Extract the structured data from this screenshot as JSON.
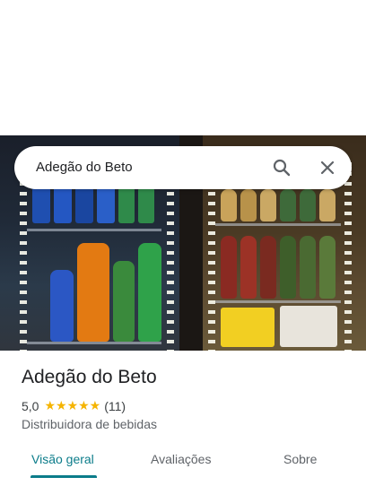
{
  "search": {
    "query": "Adegão do Beto"
  },
  "icons": {
    "search": "search-icon",
    "close": "close-icon"
  },
  "place": {
    "title": "Adegão do Beto",
    "rating": "5,0",
    "stars": "★★★★★",
    "review_count": "(11)",
    "category": "Distribuidora de bebidas"
  },
  "tabs": [
    {
      "label": "Visão geral"
    },
    {
      "label": "Avaliações"
    },
    {
      "label": "Sobre"
    }
  ],
  "colors": {
    "accent": "#0b7c8a",
    "star": "#f5b400"
  }
}
